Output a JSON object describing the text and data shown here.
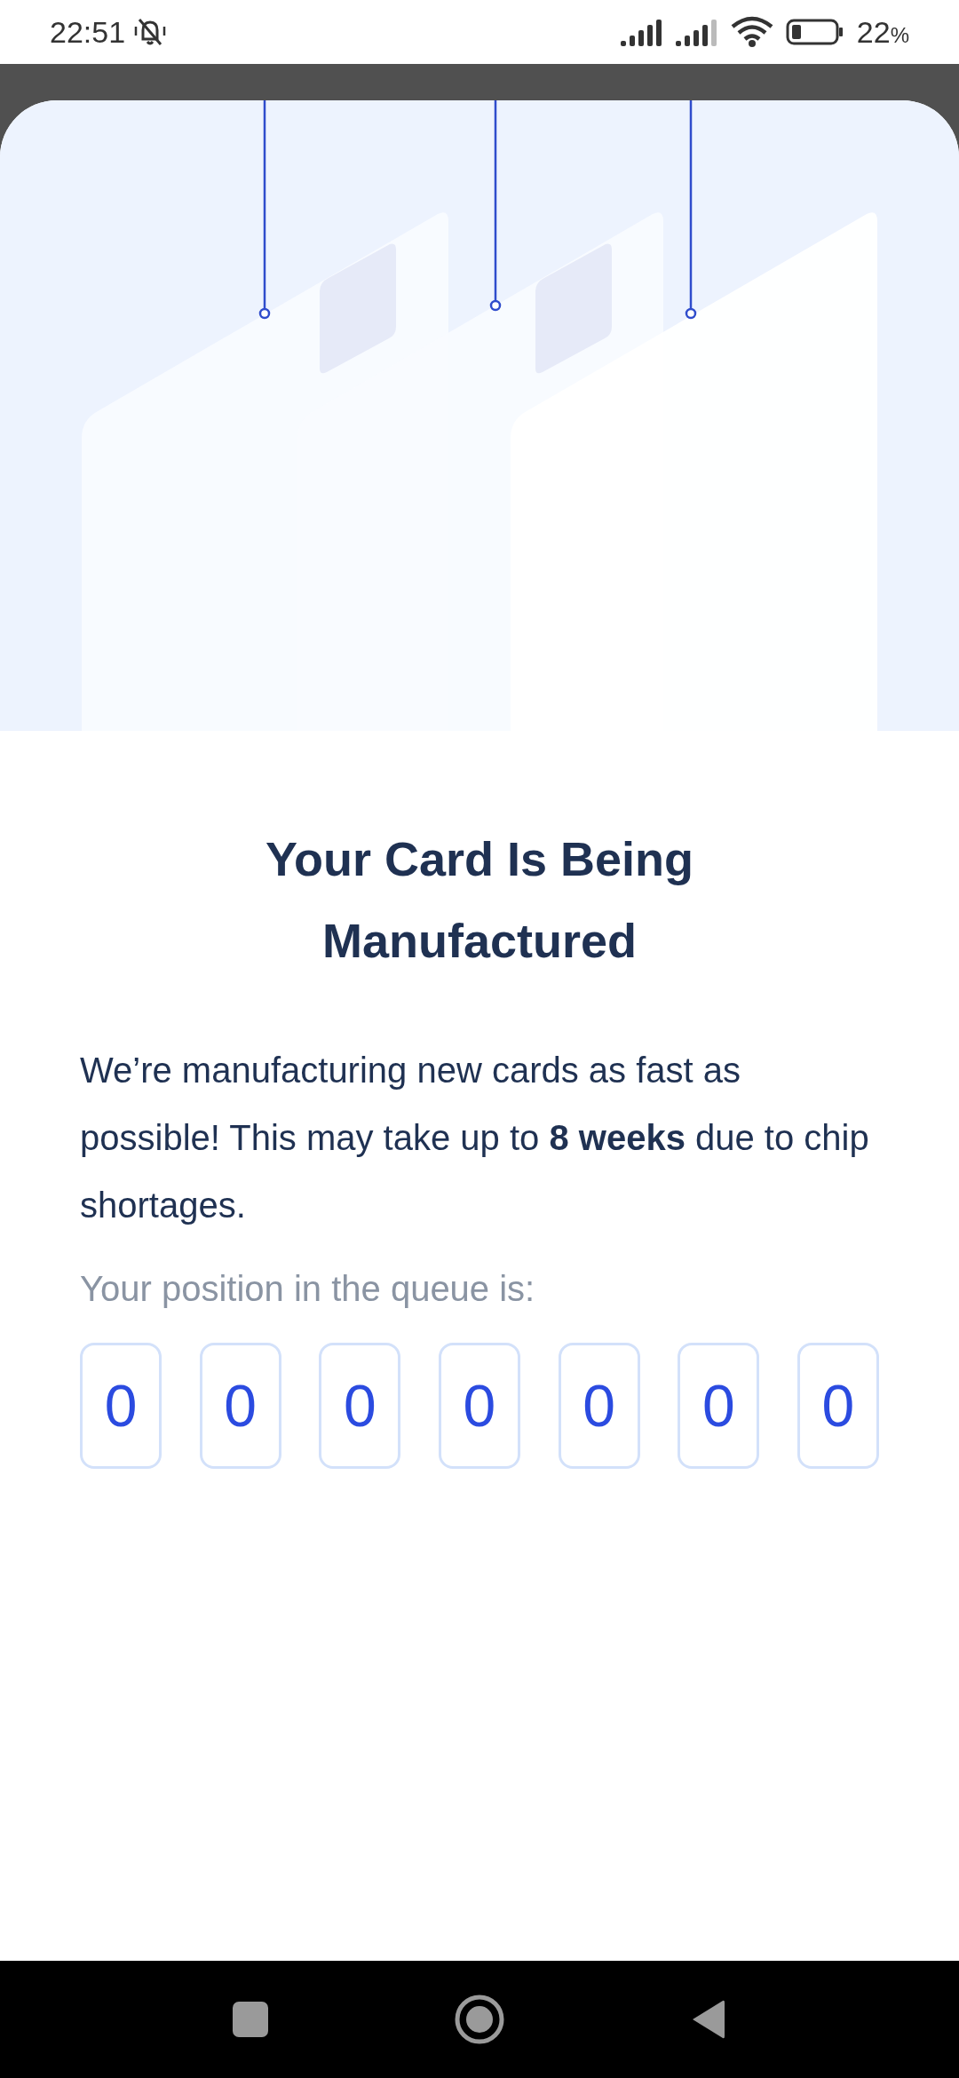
{
  "status_bar": {
    "time": "22:51",
    "battery_level": "22",
    "battery_unit": "%"
  },
  "title": "Your Card Is Being Manufactured",
  "message": "We’re manufacturing new cards as fast as possible! This may take up to **8 weeks** due to chip shortages.",
  "queue_label": "Your position in the queue is:",
  "queue_digits": [
    "0",
    "0",
    "0",
    "0",
    "0",
    "0",
    "0"
  ]
}
